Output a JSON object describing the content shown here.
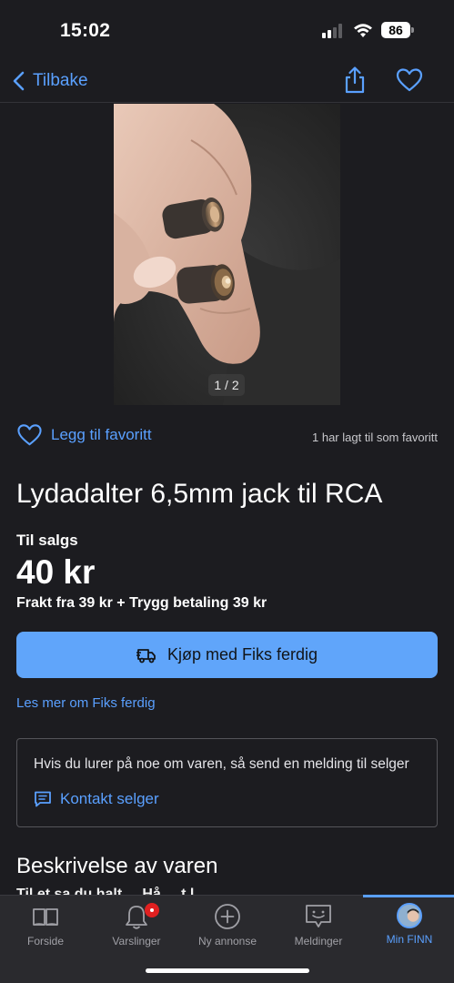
{
  "status_bar": {
    "time": "15:02",
    "battery": "86",
    "icons": [
      "signal-icon",
      "wifi-icon",
      "battery-icon"
    ]
  },
  "nav": {
    "back_label": "Tilbake",
    "icons": [
      "chevron-left-icon",
      "share-icon",
      "heart-icon"
    ]
  },
  "gallery": {
    "counter": "1 / 2"
  },
  "favorite": {
    "label": "Legg til favoritt",
    "count_text": "1 har lagt til som favoritt"
  },
  "listing": {
    "title": "Lydadalter 6,5mm jack til RCA",
    "status": "Til salgs",
    "price": "40 kr",
    "shipping": "Frakt fra 39 kr + Trygg betaling 39 kr"
  },
  "buy": {
    "label": "Kjøp med Fiks ferdig",
    "icon": "truck-icon"
  },
  "read_more": "Les mer om Fiks ferdig",
  "contact": {
    "text": "Hvis du lurer på noe om varen, så send en melding til selger",
    "button_label": "Kontakt selger",
    "icon": "chat-icon"
  },
  "description": {
    "heading": "Beskrivelse av varen",
    "peek": "Til et sa du halt ... Hå ... t l ..."
  },
  "tabs": [
    {
      "label": "Forside",
      "icon": "book-icon"
    },
    {
      "label": "Varslinger",
      "icon": "bell-icon"
    },
    {
      "label": "Ny annonse",
      "icon": "plus-circle-icon"
    },
    {
      "label": "Meldinger",
      "icon": "message-icon"
    },
    {
      "label": "Min FINN",
      "icon": "avatar"
    }
  ],
  "colors": {
    "background": "#1c1c20",
    "accent": "#5aa0ff",
    "button": "#60a5fa",
    "badge": "#e02020"
  }
}
